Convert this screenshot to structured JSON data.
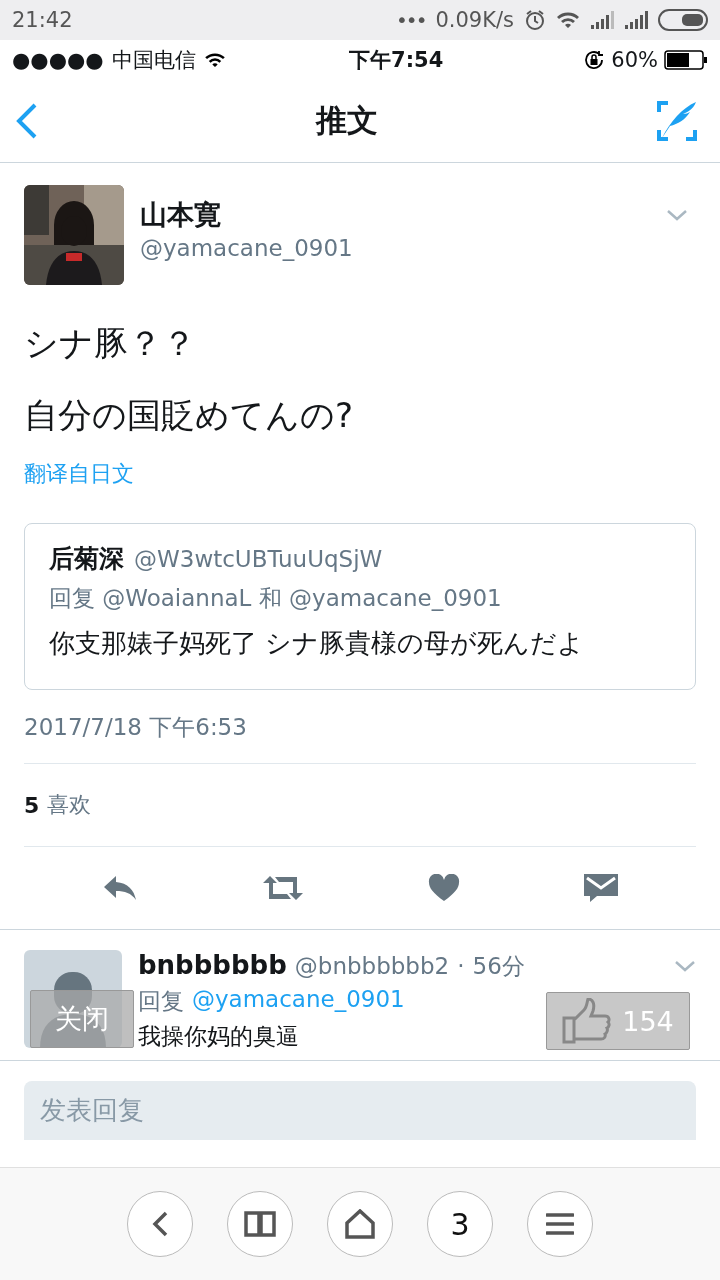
{
  "system_bar": {
    "time": "21:42",
    "dots": "•••",
    "speed": "0.09K/s"
  },
  "status_bar": {
    "signal_dots": "●●●●●",
    "carrier": "中国电信",
    "time": "下午7:54",
    "battery": "60%"
  },
  "nav": {
    "title": "推文"
  },
  "tweet": {
    "name": "山本寛",
    "handle": "@yamacane_0901",
    "lines": [
      "シナ豚？？",
      "自分の国貶めてんの?"
    ],
    "translate": "翻译自日文",
    "quote": {
      "name": "后菊深",
      "handle": "@W3wtcUBTuuUqSjW",
      "reply_line": "回复 @WoaiannaL 和 @yamacane_0901",
      "text": "你支那婊子妈死了 シナ豚貴様の母が死んだよ"
    },
    "date": "2017/7/18 下午6:53",
    "likes_count": "5",
    "likes_label": "喜欢"
  },
  "reply": {
    "name": "bnbbbbbb",
    "handle": "@bnbbbbbb2",
    "separator": "·",
    "time": "56分",
    "reply_prefix": "回复",
    "reply_to": "@yamacane_0901",
    "text": "我操你妈的臭逼"
  },
  "compose": {
    "placeholder": "发表回复"
  },
  "overlay": {
    "close": "关闭",
    "likes": "154"
  },
  "browser_bar": {
    "tabs": "3"
  }
}
